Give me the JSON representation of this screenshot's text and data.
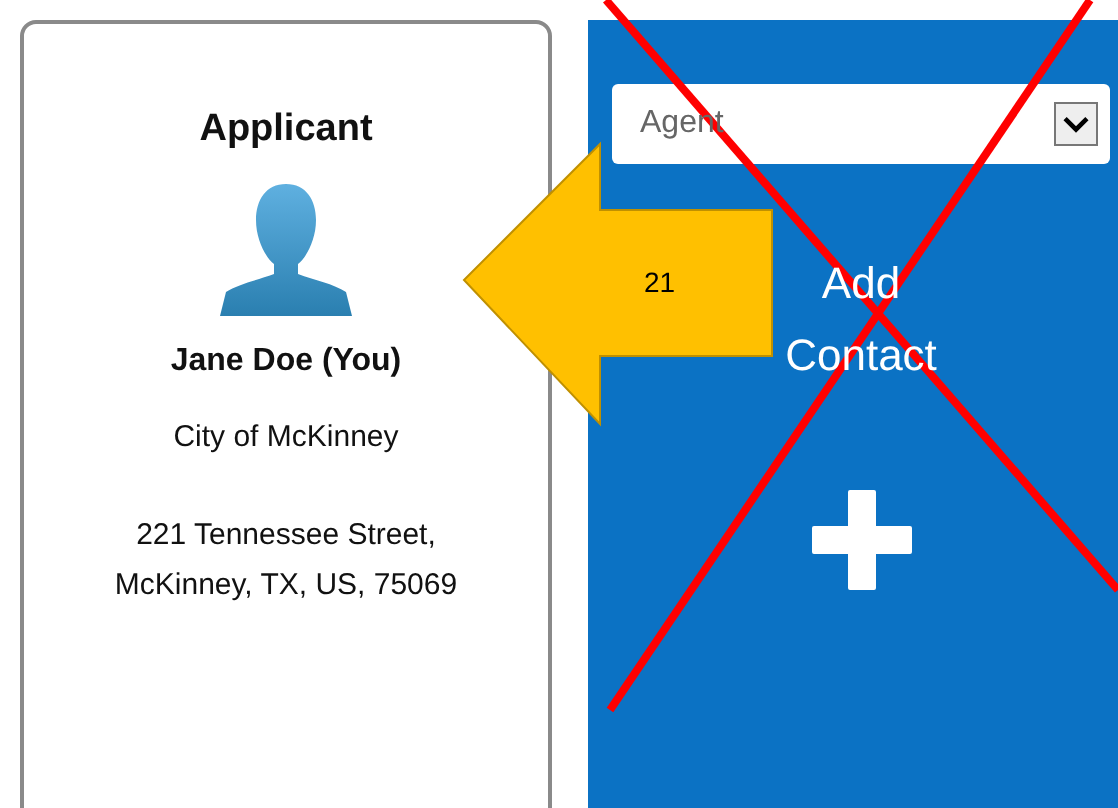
{
  "applicant_card": {
    "title": "Applicant",
    "name": "Jane Doe (You)",
    "organization": "City of McKinney",
    "address": [
      "221 Tennessee Street,",
      "McKinney, TX, US, 75069"
    ]
  },
  "contact_panel": {
    "role_select": {
      "value": "Agent"
    },
    "add_label": "Add Contact"
  },
  "annotation": {
    "label": "21"
  }
}
